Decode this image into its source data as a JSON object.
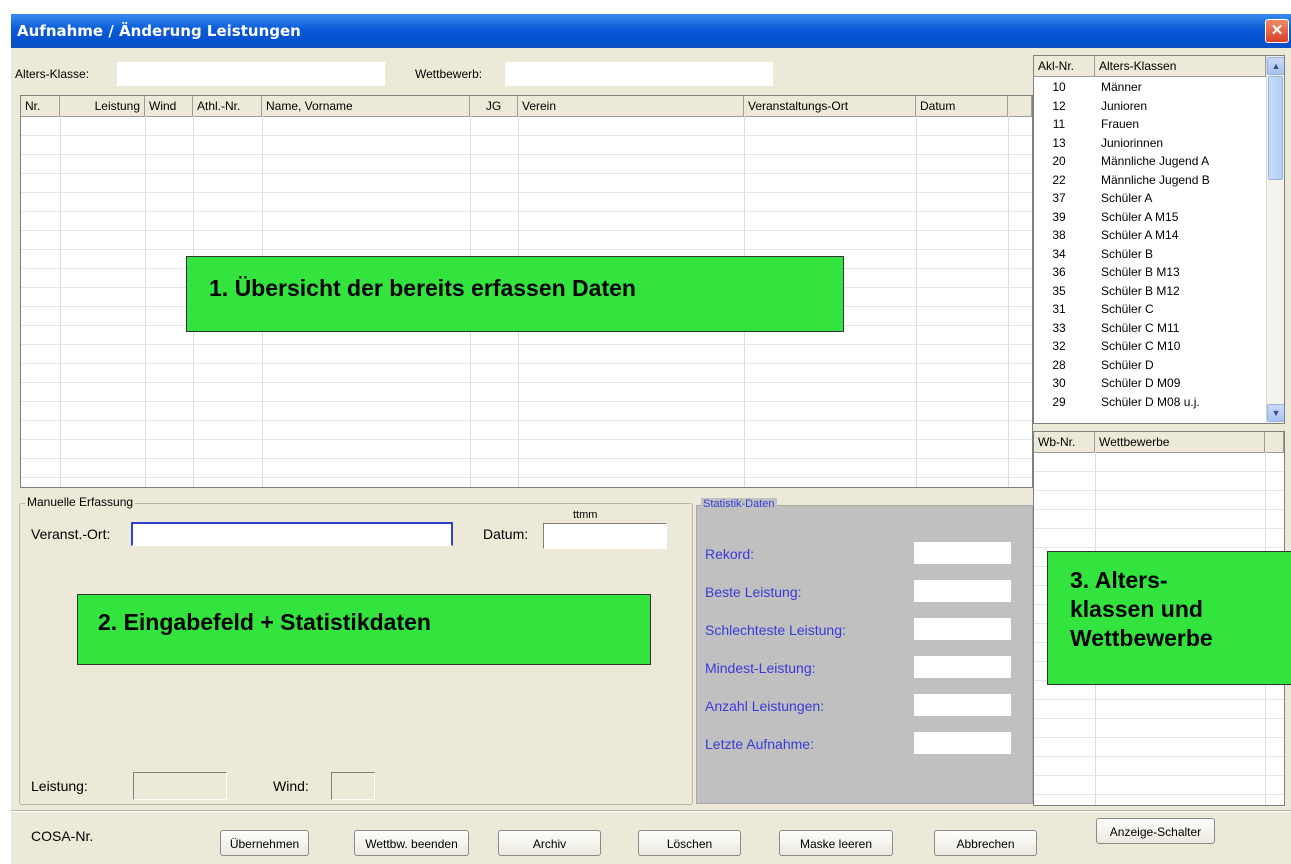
{
  "window": {
    "title": "Aufnahme / Änderung Leistungen",
    "close_label": "✕"
  },
  "filter": {
    "alters_klasse_label": "Alters-Klasse:",
    "alters_klasse_value": "",
    "wettbewerb_label": "Wettbewerb:",
    "wettbewerb_value": ""
  },
  "main_table": {
    "columns": [
      "Nr.",
      "Leistung",
      "Wind",
      "Athl.-Nr.",
      "Name, Vorname",
      "JG",
      "Verein",
      "Veranstaltungs-Ort",
      "Datum"
    ],
    "rows": []
  },
  "callouts": {
    "overview": "1. Übersicht der bereits erfassen Daten",
    "input": "2. Eingabefeld + Statistikdaten",
    "classes_line1": "3. Alters-",
    "classes_line2": "klassen und",
    "classes_line3": "Wettbewerbe"
  },
  "manual": {
    "group_label": "Manuelle Erfassung",
    "ort_label": "Veranst.-Ort:",
    "ort_value": "",
    "datum_hint": "ttmm",
    "datum_label": "Datum:",
    "datum_value": "",
    "leistung_label": "Leistung:",
    "leistung_value": "",
    "wind_label": "Wind:",
    "wind_value": ""
  },
  "stats": {
    "group_label": "Statistik-Daten",
    "items": [
      "Rekord:",
      "Beste Leistung:",
      "Schlechteste Leistung:",
      "Mindest-Leistung:",
      "Anzahl Leistungen:",
      "Letzte Aufnahme:"
    ]
  },
  "akl_table": {
    "col_nr": "Akl-Nr.",
    "col_name": "Alters-Klassen",
    "rows": [
      {
        "nr": "10",
        "name": "Männer"
      },
      {
        "nr": "12",
        "name": "Junioren"
      },
      {
        "nr": "11",
        "name": "Frauen"
      },
      {
        "nr": "13",
        "name": "Juniorinnen"
      },
      {
        "nr": "20",
        "name": "Männliche Jugend A"
      },
      {
        "nr": "22",
        "name": "Männliche Jugend B"
      },
      {
        "nr": "37",
        "name": "Schüler A"
      },
      {
        "nr": "39",
        "name": "Schüler A  M15"
      },
      {
        "nr": "38",
        "name": "Schüler A  M14"
      },
      {
        "nr": "34",
        "name": "Schüler B"
      },
      {
        "nr": "36",
        "name": "Schüler B  M13"
      },
      {
        "nr": "35",
        "name": "Schüler B  M12"
      },
      {
        "nr": "31",
        "name": "Schüler C"
      },
      {
        "nr": "33",
        "name": "Schüler C  M11"
      },
      {
        "nr": "32",
        "name": "Schüler C  M10"
      },
      {
        "nr": "28",
        "name": "Schüler D"
      },
      {
        "nr": "30",
        "name": "Schüler D  M09"
      },
      {
        "nr": "29",
        "name": "Schüler D  M08 u.j."
      }
    ]
  },
  "wb_table": {
    "col_nr": "Wb-Nr.",
    "col_name": "Wettbewerbe"
  },
  "bottom": {
    "cosa_label": "COSA-Nr.",
    "buttons": {
      "uebernehmen": "Übernehmen",
      "beenden": "Wettbw. beenden",
      "archiv": "Archiv",
      "loeschen": "Löschen",
      "leeren": "Maske leeren",
      "abbrechen": "Abbrechen",
      "anzeige": "Anzeige-Schalter"
    }
  },
  "colors": {
    "callout": "#33e43f",
    "titlebar": "#0a5bd8",
    "stats_panel": "#c0c0c0",
    "stats_text": "#3a3ad8"
  }
}
